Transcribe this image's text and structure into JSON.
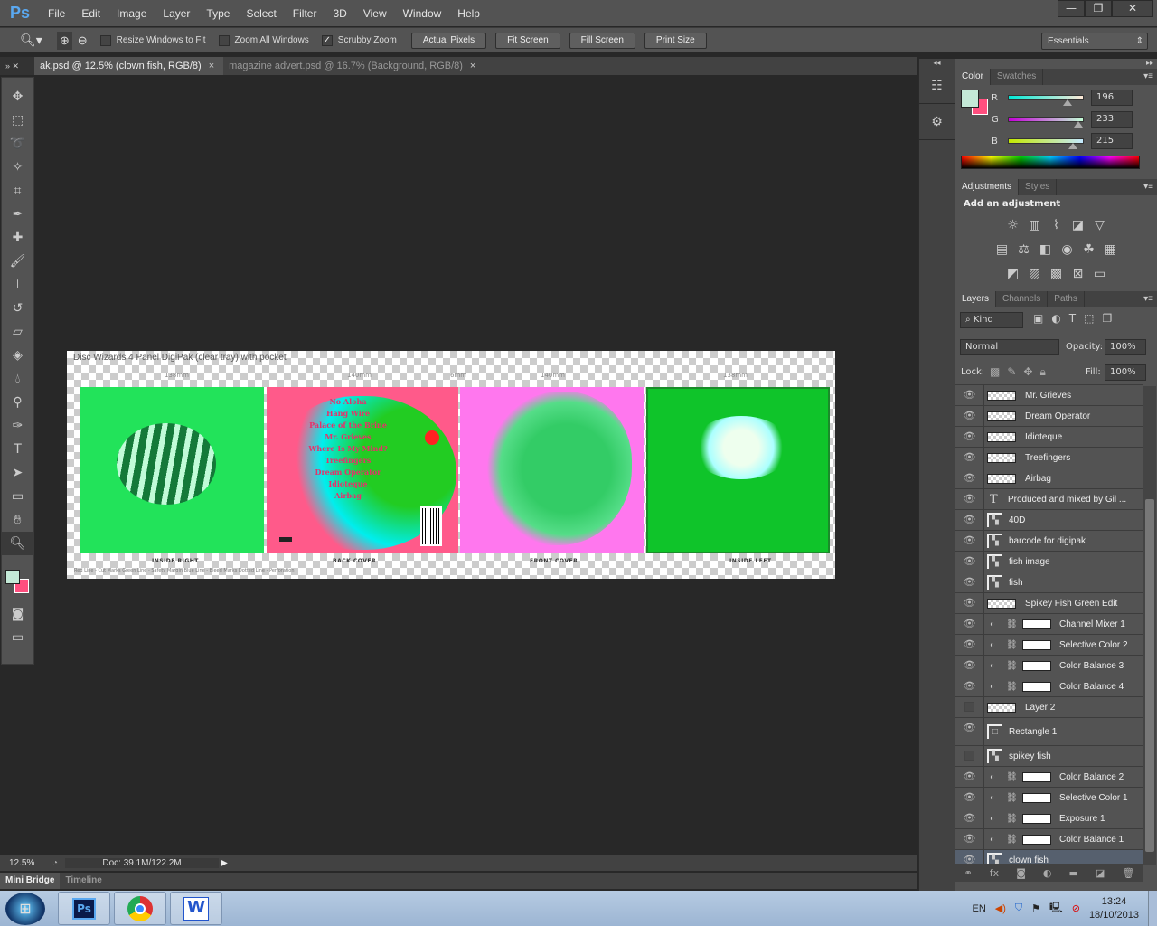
{
  "app": {
    "logo": "Ps",
    "menus": [
      "File",
      "Edit",
      "Image",
      "Layer",
      "Type",
      "Select",
      "Filter",
      "3D",
      "View",
      "Window",
      "Help"
    ],
    "window_controls": [
      "minimize",
      "restore",
      "close"
    ]
  },
  "options": {
    "resize_windows": {
      "label": "Resize Windows to Fit",
      "checked": false
    },
    "zoom_all": {
      "label": "Zoom All Windows",
      "checked": false
    },
    "scrubby": {
      "label": "Scrubby Zoom",
      "checked": true
    },
    "buttons": [
      "Actual Pixels",
      "Fit Screen",
      "Fill Screen",
      "Print Size"
    ],
    "workspace": "Essentials"
  },
  "tabs": [
    {
      "label": "ak.psd @ 12.5% (clown fish, RGB/8)",
      "active": true
    },
    {
      "label": "magazine advert.psd @ 16.7% (Background, RGB/8)",
      "active": false
    }
  ],
  "tools": [
    "move",
    "marquee",
    "lasso",
    "quick-selection",
    "crop",
    "eyedropper",
    "healing-brush",
    "brush",
    "clone-stamp",
    "history-brush",
    "eraser",
    "paint-bucket",
    "blur",
    "dodge",
    "pen",
    "type",
    "path-selection",
    "rectangle",
    "hand",
    "zoom"
  ],
  "canvas": {
    "title": "Disc Wizards 4 Panel DigiPak (clear tray) with pocket",
    "measures": [
      "138mm",
      "140mm",
      "6mm",
      "140mm",
      "138mm"
    ],
    "panel_labels": [
      "INSIDE RIGHT",
      "BACK COVER",
      "FRONT COVER",
      "INSIDE LEFT"
    ],
    "tracks": [
      "No Aloha",
      "Hang Wire",
      "Palace of the Brine",
      "Mr. Grieves",
      "Where Is My Mind?",
      "Treefingers",
      "Dream Operator",
      "Idioteque",
      "Airbag"
    ],
    "legend": "Red Line - Cut Marks  Green Line - Safety Margin  Blue Line - Bleed Marks  Dotted Line - Perforation",
    "colors": {
      "inside_right": "#22e35a",
      "back_cover": "#ff5a8a",
      "front_cover": "#ff77ee",
      "inside_left": "#0fc42a"
    }
  },
  "color_panel": {
    "tabs": [
      "Color",
      "Swatches"
    ],
    "fg": "#c4e9d7",
    "bg": "#ff4f7f",
    "channels": [
      {
        "label": "R",
        "value": "196"
      },
      {
        "label": "G",
        "value": "233"
      },
      {
        "label": "B",
        "value": "215"
      }
    ]
  },
  "adjustments": {
    "tabs": [
      "Adjustments",
      "Styles"
    ],
    "heading": "Add an adjustment"
  },
  "layers_panel": {
    "tabs": [
      "Layers",
      "Channels",
      "Paths"
    ],
    "kind": "Kind",
    "blend": "Normal",
    "opacity_label": "Opacity:",
    "opacity": "100%",
    "lock_label": "Lock:",
    "fill_label": "Fill:",
    "fill": "100%",
    "layers": [
      {
        "name": "Mr. Grieves",
        "type": "pixel",
        "visible": true
      },
      {
        "name": "Dream Operator",
        "type": "pixel",
        "visible": true
      },
      {
        "name": "Idioteque",
        "type": "pixel",
        "visible": true
      },
      {
        "name": "Treefingers",
        "type": "pixel",
        "visible": true
      },
      {
        "name": "Airbag",
        "type": "pixel",
        "visible": true
      },
      {
        "name": "Produced and mixed by Gil ...",
        "type": "text",
        "visible": true
      },
      {
        "name": "40D",
        "type": "smart",
        "visible": true
      },
      {
        "name": "barcode for digipak",
        "type": "smart",
        "visible": true
      },
      {
        "name": "fish image",
        "type": "smart",
        "visible": true
      },
      {
        "name": "fish",
        "type": "smart",
        "visible": true
      },
      {
        "name": "Spikey Fish Green Edit",
        "type": "pixel",
        "visible": true
      },
      {
        "name": "Channel Mixer 1",
        "type": "adjustment",
        "visible": true
      },
      {
        "name": "Selective Color 2",
        "type": "adjustment",
        "visible": true
      },
      {
        "name": "Color Balance 3",
        "type": "adjustment",
        "visible": true
      },
      {
        "name": "Color Balance 4",
        "type": "adjustment",
        "visible": true
      },
      {
        "name": "Layer 2",
        "type": "pixel",
        "visible": false
      },
      {
        "name": "Rectangle 1",
        "type": "shape",
        "visible": true
      },
      {
        "name": "spikey fish",
        "type": "smart",
        "visible": false
      },
      {
        "name": "Color Balance 2",
        "type": "adjustment",
        "visible": true
      },
      {
        "name": "Selective Color 1",
        "type": "adjustment",
        "visible": true
      },
      {
        "name": "Exposure 1",
        "type": "adjustment",
        "visible": true
      },
      {
        "name": "Color Balance 1",
        "type": "adjustment",
        "visible": true
      },
      {
        "name": "clown fish",
        "type": "smart",
        "visible": true,
        "selected": true
      }
    ]
  },
  "status": {
    "zoom": "12.5%",
    "doc": "Doc: 39.1M/122.2M"
  },
  "bottom_tabs": [
    "Mini Bridge",
    "Timeline"
  ],
  "taskbar": {
    "apps": [
      "Photoshop",
      "Chrome",
      "Word"
    ],
    "lang": "EN",
    "time": "13:24",
    "date": "18/10/2013"
  }
}
